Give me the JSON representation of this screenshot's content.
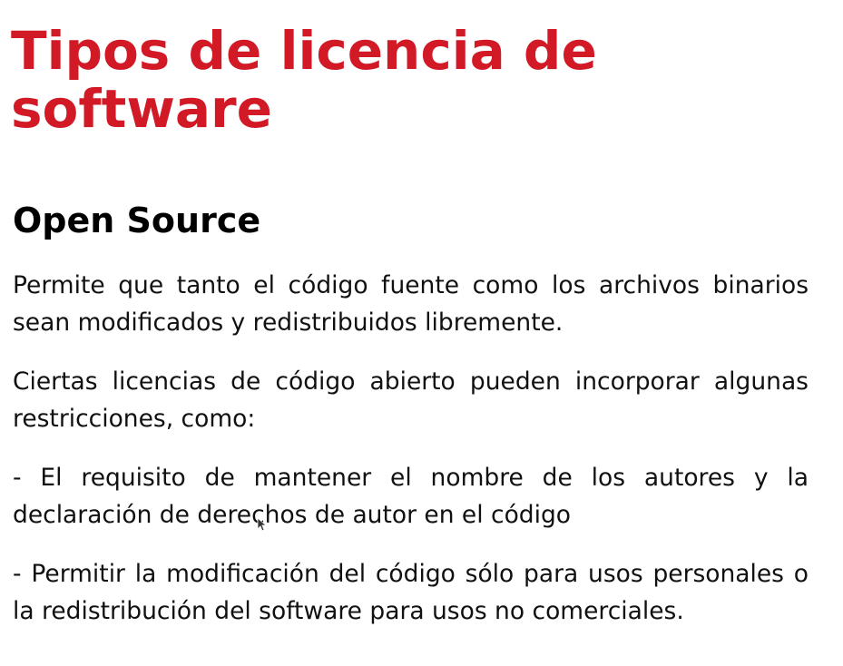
{
  "slide": {
    "title": "Tipos de licencia de software",
    "subtitle": "Open Source",
    "paragraphs": [
      "Permite que tanto el código fuente como los archivos binarios sean modificados y redistribuidos libremente.",
      "Ciertas licencias de código abierto pueden incorporar algunas restricciones, como:",
      "- El requisito de mantener el nombre de los autores y la declaración de derechos de autor en el código",
      "- Permitir la modificación del código sólo para usos personales o la redistribución del software para usos no comerciales."
    ]
  },
  "colors": {
    "title": "#d11a26",
    "text": "#111111",
    "background": "#ffffff"
  },
  "icons": {
    "cursor": "mouse-pointer-icon"
  }
}
